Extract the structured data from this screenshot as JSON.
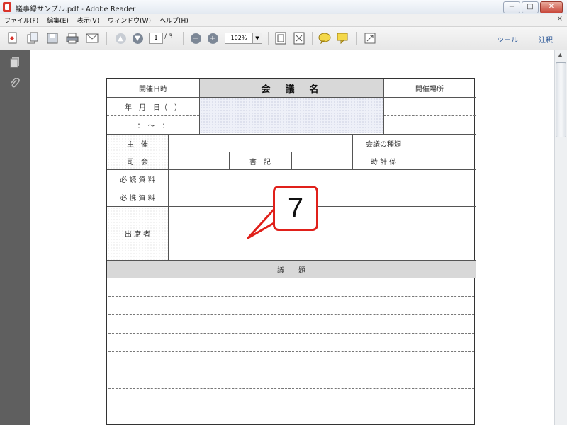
{
  "window": {
    "title": "議事録サンプル.pdf - Adobe Reader",
    "btn_min": "−",
    "btn_max": "□",
    "btn_close": "✕"
  },
  "menu": {
    "items": [
      "ファイル(F)",
      "編集(E)",
      "表示(V)",
      "ウィンドウ(W)",
      "ヘルプ(H)"
    ],
    "close_glyph": "×"
  },
  "toolbar": {
    "page_current": "1",
    "page_total": "/ 3",
    "zoom": "102%",
    "zoom_drop": "▼",
    "tools_label": "ツール",
    "comment_label": "注釈"
  },
  "form": {
    "date_label": "開催日時",
    "meeting_name": "会　議　名",
    "place_label": "開催場所",
    "date_fields": "年　月　日（　）",
    "time_fields": "：　〜　：",
    "host_label": "主　催",
    "meeting_type_label": "会議の種類",
    "chair_label": "司　会",
    "secretary_label": "書　記",
    "timekeeper_label": "時 計 係",
    "required_reading_label": "必 読 資 料",
    "required_bring_label": "必 携 資 料",
    "attendees_label": "出 席 者",
    "agenda_label": "議　　題"
  },
  "callout": {
    "number": "7"
  },
  "colors": {
    "callout_border": "#e0201a",
    "sidebar": "#5f5f5f",
    "link": "#2b5797"
  }
}
